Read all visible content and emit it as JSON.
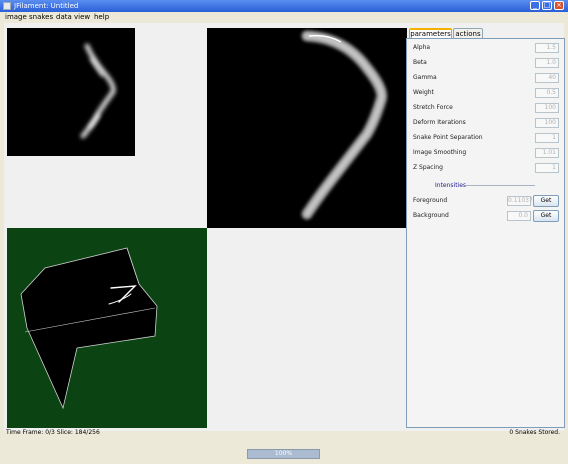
{
  "window": {
    "title": "JFilament: Untitled",
    "minimize": "_",
    "maximize": "□",
    "close": "×"
  },
  "menu": [
    "image",
    "snakes",
    "data",
    "view",
    "help"
  ],
  "tabs": [
    {
      "label": "parameters",
      "active": true
    },
    {
      "label": "actions",
      "active": false
    }
  ],
  "parameters": [
    {
      "label": "Alpha",
      "value": "1.5"
    },
    {
      "label": "Beta",
      "value": "1.0"
    },
    {
      "label": "Gamma",
      "value": "40"
    },
    {
      "label": "Weight",
      "value": "0.5"
    },
    {
      "label": "Stretch Force",
      "value": "100"
    },
    {
      "label": "Deform Iterations",
      "value": "100"
    },
    {
      "label": "Snake Point Separation",
      "value": "1"
    },
    {
      "label": "Image Smoothing",
      "value": "1.01"
    },
    {
      "label": "Z Spacing",
      "value": "1"
    }
  ],
  "intensities": {
    "title": "Intensities",
    "foreground": {
      "label": "Foreground",
      "value": "0.11037",
      "button": "Get"
    },
    "background": {
      "label": "Background",
      "value": "0.0",
      "button": "Get"
    }
  },
  "status": {
    "left": "Time Frame: 0/3  Slice: 184/256",
    "right": "0 Snakes Stored."
  },
  "progress": {
    "text": "100%",
    "fraction": 1.0
  },
  "colors": {
    "view3d_background": "#0b4412",
    "image_background": "#000000",
    "tab_accent": "#f5b100"
  }
}
